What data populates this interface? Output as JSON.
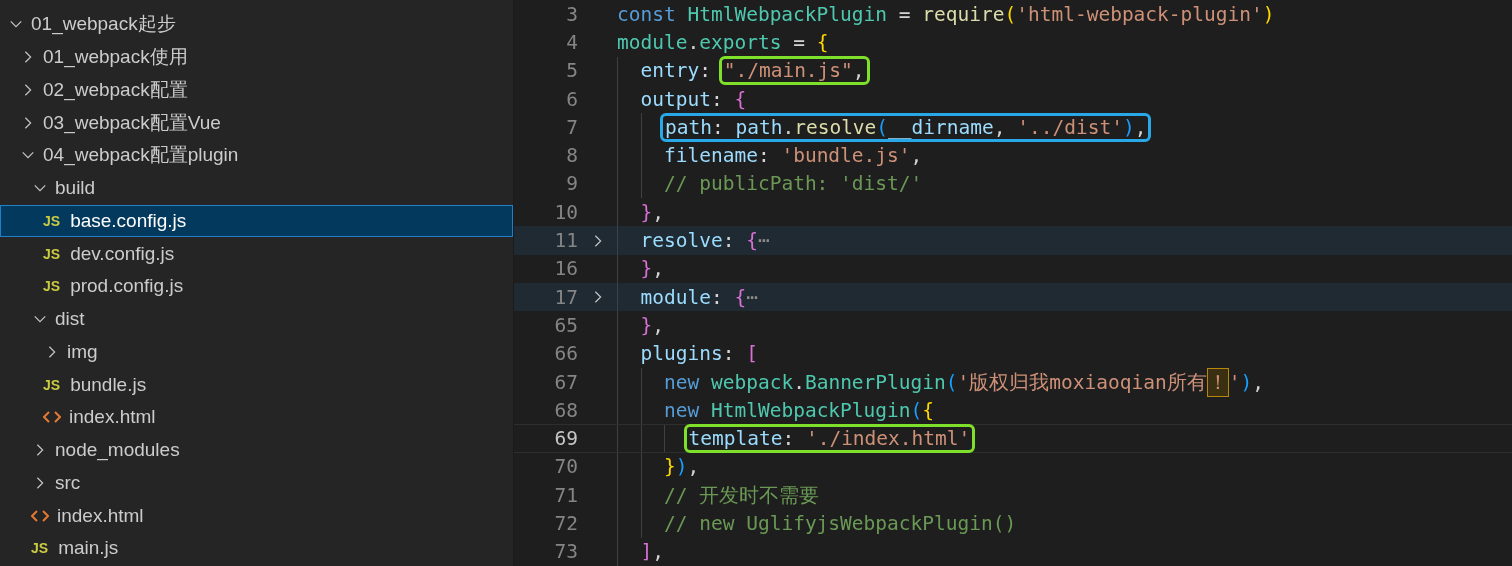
{
  "explorer": {
    "tree": [
      {
        "label": "01_webpack起步",
        "kind": "folder",
        "expanded": true,
        "selected": false,
        "children": [
          {
            "label": "01_webpack使用",
            "kind": "folder",
            "expanded": false,
            "selected": false
          },
          {
            "label": "02_webpack配置",
            "kind": "folder",
            "expanded": false,
            "selected": false
          },
          {
            "label": "03_webpack配置Vue",
            "kind": "folder",
            "expanded": false,
            "selected": false
          },
          {
            "label": "04_webpack配置plugin",
            "kind": "folder",
            "expanded": true,
            "selected": false,
            "children": [
              {
                "label": "build",
                "kind": "folder",
                "expanded": true,
                "selected": false,
                "children": [
                  {
                    "label": "base.config.js",
                    "kind": "js",
                    "icon_text": "JS",
                    "selected": true
                  },
                  {
                    "label": "dev.config.js",
                    "kind": "js",
                    "icon_text": "JS",
                    "selected": false
                  },
                  {
                    "label": "prod.config.js",
                    "kind": "js",
                    "icon_text": "JS",
                    "selected": false
                  }
                ]
              },
              {
                "label": "dist",
                "kind": "folder",
                "expanded": true,
                "selected": false,
                "children": [
                  {
                    "label": "img",
                    "kind": "folder",
                    "expanded": false,
                    "selected": false
                  },
                  {
                    "label": "bundle.js",
                    "kind": "js",
                    "icon_text": "JS",
                    "selected": false
                  },
                  {
                    "label": "index.html",
                    "kind": "html",
                    "selected": false
                  }
                ]
              },
              {
                "label": "node_modules",
                "kind": "folder",
                "expanded": false,
                "selected": false
              },
              {
                "label": "src",
                "kind": "folder",
                "expanded": false,
                "selected": false
              },
              {
                "label": "index.html",
                "kind": "html",
                "selected": false
              },
              {
                "label": "main.js",
                "kind": "js",
                "icon_text": "JS",
                "selected": false
              }
            ]
          }
        ]
      }
    ]
  },
  "editor": {
    "lines": [
      {
        "num": "3",
        "folded": false,
        "current": false,
        "tokens": [
          {
            "t": "const ",
            "kind": "keyword"
          },
          {
            "t": "HtmlWebpackPlugin",
            "kind": "type"
          },
          {
            "t": " = ",
            "kind": "punct"
          },
          {
            "t": "require",
            "kind": "function"
          },
          {
            "t": "(",
            "kind": "bracket1"
          },
          {
            "t": "'html-webpack-plugin'",
            "kind": "string"
          },
          {
            "t": ")",
            "kind": "bracket1"
          }
        ]
      },
      {
        "num": "4",
        "folded": false,
        "current": false,
        "tokens": [
          {
            "t": "module",
            "kind": "type"
          },
          {
            "t": ".",
            "kind": "punct"
          },
          {
            "t": "exports",
            "kind": "type"
          },
          {
            "t": " = ",
            "kind": "punct"
          },
          {
            "t": "{",
            "kind": "bracket1"
          }
        ],
        "children": [
          {
            "num": "5",
            "folded": false,
            "current": false,
            "tokens": [
              {
                "t": "entry",
                "kind": "property"
              },
              {
                "t": ": ",
                "kind": "punct"
              },
              {
                "kind": "box",
                "color": "#7ee02a",
                "tokens": [
                  {
                    "t": "\"./main.js\"",
                    "kind": "string"
                  },
                  {
                    "t": ",",
                    "kind": "punct"
                  }
                ]
              }
            ]
          },
          {
            "num": "6",
            "folded": false,
            "current": false,
            "tokens": [
              {
                "t": "output",
                "kind": "property"
              },
              {
                "t": ": ",
                "kind": "punct"
              },
              {
                "t": "{",
                "kind": "bracket2"
              }
            ],
            "children": [
              {
                "num": "7",
                "folded": false,
                "current": false,
                "tokens": [
                  {
                    "kind": "box",
                    "color": "#29a8e8",
                    "tokens": [
                      {
                        "t": "path",
                        "kind": "property"
                      },
                      {
                        "t": ": ",
                        "kind": "punct"
                      },
                      {
                        "t": "path",
                        "kind": "property"
                      },
                      {
                        "t": ".",
                        "kind": "punct"
                      },
                      {
                        "t": "resolve",
                        "kind": "function"
                      },
                      {
                        "t": "(",
                        "kind": "bracket3"
                      },
                      {
                        "t": "__dirname",
                        "kind": "property"
                      },
                      {
                        "t": ", ",
                        "kind": "punct"
                      },
                      {
                        "t": "'../dist'",
                        "kind": "string"
                      },
                      {
                        "t": ")",
                        "kind": "bracket3"
                      },
                      {
                        "t": ",",
                        "kind": "punct"
                      }
                    ]
                  }
                ]
              },
              {
                "num": "8",
                "folded": false,
                "current": false,
                "tokens": [
                  {
                    "t": "filename",
                    "kind": "property"
                  },
                  {
                    "t": ": ",
                    "kind": "punct"
                  },
                  {
                    "t": "'bundle.js'",
                    "kind": "string"
                  },
                  {
                    "t": ",",
                    "kind": "punct"
                  }
                ]
              },
              {
                "num": "9",
                "folded": false,
                "current": false,
                "tokens": [
                  {
                    "t": "// publicPath: 'dist/'",
                    "kind": "comment"
                  }
                ]
              }
            ]
          },
          {
            "num": "10",
            "folded": false,
            "current": false,
            "tokens": [
              {
                "t": "}",
                "kind": "bracket2"
              },
              {
                "t": ",",
                "kind": "punct"
              }
            ]
          },
          {
            "num": "11",
            "folded": true,
            "current": false,
            "tokens": [
              {
                "t": "resolve",
                "kind": "property"
              },
              {
                "t": ": ",
                "kind": "punct"
              },
              {
                "t": "{",
                "kind": "bracket2"
              },
              {
                "t": "⋯",
                "kind": "ellipsis"
              }
            ]
          },
          {
            "num": "16",
            "folded": false,
            "current": false,
            "tokens": [
              {
                "t": "}",
                "kind": "bracket2"
              },
              {
                "t": ",",
                "kind": "punct"
              }
            ]
          },
          {
            "num": "17",
            "folded": true,
            "current": false,
            "tokens": [
              {
                "t": "module",
                "kind": "property"
              },
              {
                "t": ": ",
                "kind": "punct"
              },
              {
                "t": "{",
                "kind": "bracket2"
              },
              {
                "t": "⋯",
                "kind": "ellipsis"
              }
            ]
          },
          {
            "num": "65",
            "folded": false,
            "current": false,
            "tokens": [
              {
                "t": "}",
                "kind": "bracket2"
              },
              {
                "t": ",",
                "kind": "punct"
              }
            ]
          },
          {
            "num": "66",
            "folded": false,
            "current": false,
            "tokens": [
              {
                "t": "plugins",
                "kind": "property"
              },
              {
                "t": ": ",
                "kind": "punct"
              },
              {
                "t": "[",
                "kind": "bracket2"
              }
            ],
            "children": [
              {
                "num": "67",
                "folded": false,
                "current": false,
                "tokens": [
                  {
                    "t": "new ",
                    "kind": "keyword"
                  },
                  {
                    "t": "webpack",
                    "kind": "type"
                  },
                  {
                    "t": ".",
                    "kind": "punct"
                  },
                  {
                    "t": "BannerPlugin",
                    "kind": "type"
                  },
                  {
                    "t": "(",
                    "kind": "bracket3"
                  },
                  {
                    "t": "'版权归我moxiaoqian所有",
                    "kind": "string"
                  },
                  {
                    "t": "！",
                    "kind": "warning"
                  },
                  {
                    "t": "'",
                    "kind": "string"
                  },
                  {
                    "t": ")",
                    "kind": "bracket3"
                  },
                  {
                    "t": ",",
                    "kind": "punct"
                  }
                ]
              },
              {
                "num": "68",
                "folded": false,
                "current": false,
                "tokens": [
                  {
                    "t": "new ",
                    "kind": "keyword"
                  },
                  {
                    "t": "HtmlWebpackPlugin",
                    "kind": "type"
                  },
                  {
                    "t": "(",
                    "kind": "bracket3"
                  },
                  {
                    "t": "{",
                    "kind": "bracket1"
                  }
                ],
                "children": [
                  {
                    "num": "69",
                    "folded": false,
                    "current": true,
                    "tokens": [
                      {
                        "kind": "box",
                        "color": "#7ee02a",
                        "tokens": [
                          {
                            "t": "template",
                            "kind": "property"
                          },
                          {
                            "t": ": ",
                            "kind": "punct"
                          },
                          {
                            "t": "'./index.html'",
                            "kind": "string"
                          }
                        ]
                      }
                    ]
                  }
                ]
              },
              {
                "num": "70",
                "folded": false,
                "current": false,
                "tokens": [
                  {
                    "t": "}",
                    "kind": "bracket1"
                  },
                  {
                    "t": ")",
                    "kind": "bracket3"
                  },
                  {
                    "t": ",",
                    "kind": "punct"
                  }
                ]
              },
              {
                "num": "71",
                "folded": false,
                "current": false,
                "tokens": [
                  {
                    "t": "// 开发时不需要",
                    "kind": "comment"
                  }
                ]
              },
              {
                "num": "72",
                "folded": false,
                "current": false,
                "tokens": [
                  {
                    "t": "// new UglifyjsWebpackPlugin()",
                    "kind": "comment"
                  }
                ]
              }
            ]
          },
          {
            "num": "73",
            "folded": false,
            "current": false,
            "tokens": [
              {
                "t": "]",
                "kind": "bracket2"
              },
              {
                "t": ",",
                "kind": "punct"
              }
            ]
          }
        ]
      }
    ]
  }
}
